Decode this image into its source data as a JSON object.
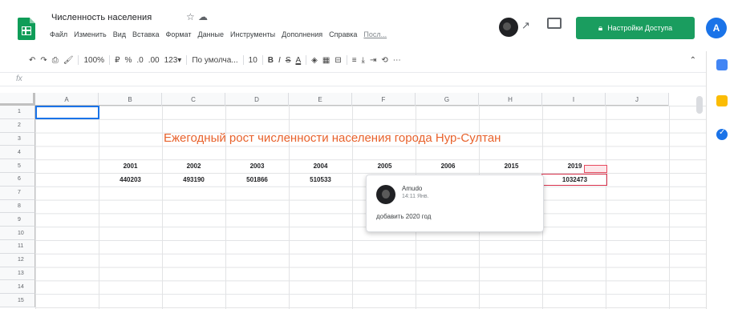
{
  "doc": {
    "title": "Численность населения",
    "menu": [
      "Файл",
      "Изменить",
      "Вид",
      "Вставка",
      "Формат",
      "Данные",
      "Инструменты",
      "Дополнения",
      "Справка"
    ],
    "last_edit": "Посл..."
  },
  "header": {
    "share_label": "Настройки Доступа",
    "account_initial": "A"
  },
  "toolbar": {
    "zoom": "100%",
    "currency": "₽",
    "percent": "%",
    "decimals_less": ".0",
    "decimals_more": ".00",
    "number_format": "123▾",
    "font": "По умолча...",
    "font_size": "10",
    "bold": "B",
    "italic": "I",
    "strike": "S",
    "text_color": "A"
  },
  "grid": {
    "columns": [
      "A",
      "B",
      "C",
      "D",
      "E",
      "F",
      "G",
      "H",
      "I",
      "J"
    ],
    "rows": [
      "1",
      "2",
      "3",
      "4",
      "5",
      "6",
      "7",
      "8",
      "9",
      "10",
      "11",
      "12",
      "13",
      "14",
      "15"
    ]
  },
  "sheet": {
    "title": "Ежегодный рост численности населения города Нур-Султан",
    "years": [
      "2001",
      "2002",
      "2003",
      "2004",
      "2005",
      "2006",
      "2015",
      "2019"
    ],
    "values": [
      "440203",
      "493190",
      "501866",
      "510533",
      "",
      "",
      "",
      "1032473"
    ]
  },
  "comment": {
    "author": "Amudo",
    "time": "14:11 Янв.",
    "text": "добавить 2020 год"
  }
}
